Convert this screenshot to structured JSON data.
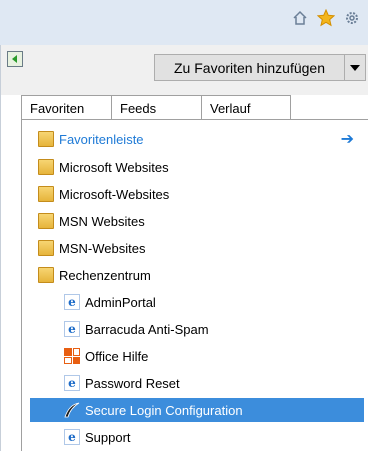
{
  "toolbar": {
    "icons": [
      "home-icon",
      "favorites-star-icon",
      "settings-gear-icon"
    ]
  },
  "panel": {
    "add_favorites_label": "Zu Favoriten hinzufügen",
    "tabs": [
      {
        "label": "Favoriten"
      },
      {
        "label": "Feeds"
      },
      {
        "label": "Verlauf"
      }
    ],
    "items": [
      {
        "label": "Favoritenleiste",
        "icon": "folder-icon"
      },
      {
        "label": "Microsoft Websites",
        "icon": "folder-icon"
      },
      {
        "label": "Microsoft-Websites",
        "icon": "folder-icon"
      },
      {
        "label": "MSN Websites",
        "icon": "folder-icon"
      },
      {
        "label": "MSN-Websites",
        "icon": "folder-icon"
      },
      {
        "label": "Rechenzentrum",
        "icon": "folder-icon"
      },
      {
        "label": "AdminPortal",
        "icon": "ie-page-icon"
      },
      {
        "label": "Barracuda Anti-Spam",
        "icon": "ie-page-icon"
      },
      {
        "label": "Office Hilfe",
        "icon": "office-icon"
      },
      {
        "label": "Password Reset",
        "icon": "ie-page-icon"
      },
      {
        "label": "Secure Login Configuration",
        "icon": "swoosh-icon"
      },
      {
        "label": "Support",
        "icon": "ie-page-icon"
      }
    ]
  },
  "colors": {
    "selection": "#3c8ddc",
    "link_blue": "#1e7ad6",
    "chrome_blue": "#dfe8f3"
  }
}
